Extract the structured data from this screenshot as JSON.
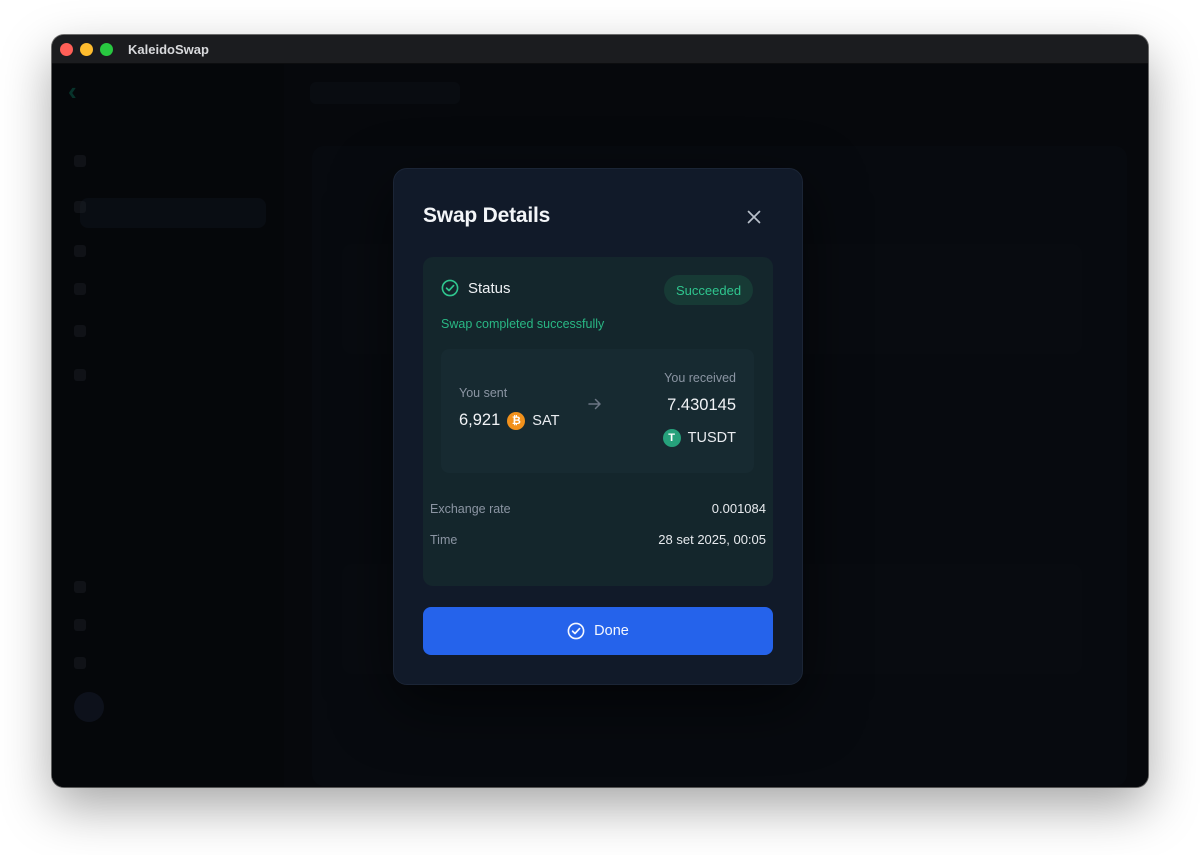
{
  "window": {
    "title": "KaleidoSwap"
  },
  "modal": {
    "title": "Swap Details",
    "status_label": "Status",
    "status_badge": "Succeeded",
    "success_message": "Swap completed successfully",
    "sent": {
      "label": "You sent",
      "amount": "6,921",
      "unit": "SAT",
      "icon": "bitcoin-icon"
    },
    "received": {
      "label": "You received",
      "amount": "7.430145",
      "unit": "TUSDT",
      "icon": "tether-icon"
    },
    "exchange_rate": {
      "label": "Exchange rate",
      "value": "0.001084"
    },
    "time": {
      "label": "Time",
      "value": "28 set 2025, 00:05"
    },
    "done_label": "Done"
  },
  "colors": {
    "accent": "#2563eb",
    "success": "#2fc58e",
    "bitcoin": "#f2911b",
    "tether": "#26a17b"
  }
}
